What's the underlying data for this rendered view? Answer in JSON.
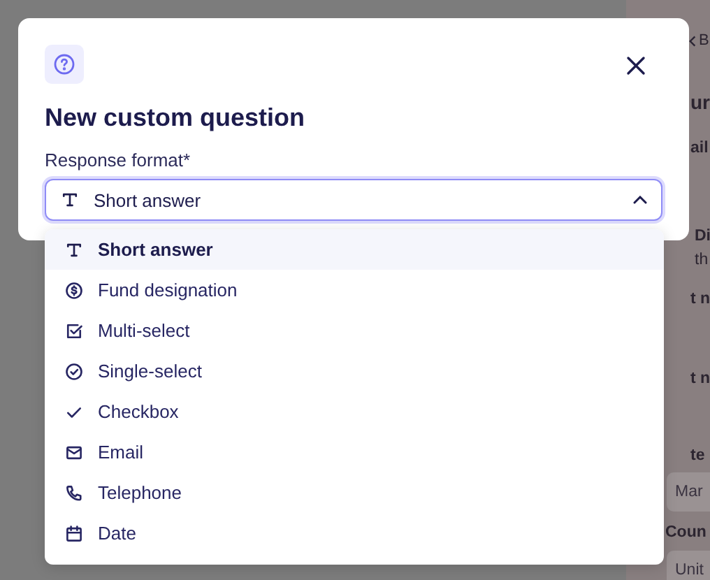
{
  "background": {
    "fragments": [
      {
        "kind": "back",
        "text": "B"
      },
      {
        "kind": "heading",
        "text": "ur"
      },
      {
        "kind": "label",
        "text": "ail"
      },
      {
        "kind": "label",
        "text": "Di"
      },
      {
        "kind": "body",
        "text": "th"
      },
      {
        "kind": "label",
        "text": "t n"
      },
      {
        "kind": "label",
        "text": "t n"
      },
      {
        "kind": "label",
        "text": "te"
      },
      {
        "kind": "input",
        "text": "Mar"
      },
      {
        "kind": "label",
        "text": "Coun"
      },
      {
        "kind": "input",
        "text": "Unit"
      }
    ]
  },
  "dialog": {
    "title": "New custom question",
    "field": {
      "label": "Response format*",
      "value": "Short answer",
      "expanded": true
    },
    "options": [
      {
        "label": "Short answer",
        "kind": "text",
        "selected": true
      },
      {
        "label": "Fund designation",
        "kind": "fund",
        "selected": false
      },
      {
        "label": "Multi-select",
        "kind": "multi",
        "selected": false
      },
      {
        "label": "Single-select",
        "kind": "single",
        "selected": false
      },
      {
        "label": "Checkbox",
        "kind": "checkbox",
        "selected": false
      },
      {
        "label": "Email",
        "kind": "email",
        "selected": false
      },
      {
        "label": "Telephone",
        "kind": "phone",
        "selected": false
      },
      {
        "label": "Date",
        "kind": "date",
        "selected": false
      }
    ]
  }
}
